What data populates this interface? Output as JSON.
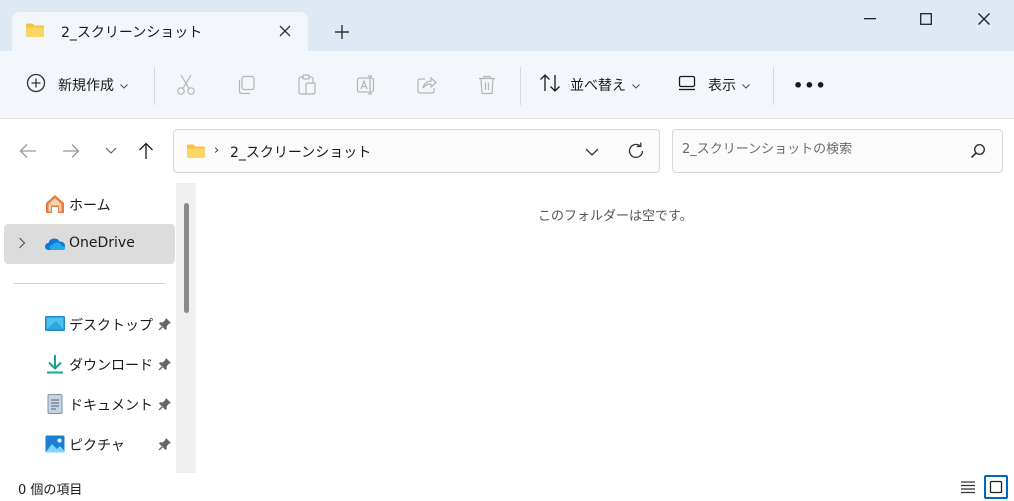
{
  "tab": {
    "title": "2_スクリーンショット",
    "icon": "folder-icon"
  },
  "window": {
    "controls": [
      "minimize",
      "maximize",
      "close"
    ]
  },
  "toolbar": {
    "new_label": "新規作成",
    "sort_label": "並べ替え",
    "view_label": "表示",
    "more_label": "•••",
    "disabled_actions": [
      "cut",
      "copy",
      "paste",
      "rename",
      "share",
      "delete"
    ]
  },
  "address": {
    "crumb": "2_スクリーンショット",
    "separator": "›"
  },
  "search": {
    "placeholder": "2_スクリーンショットの検索"
  },
  "sidebar": {
    "items": [
      {
        "label": "ホーム",
        "icon": "home-icon"
      },
      {
        "label": "OneDrive",
        "icon": "cloud-icon",
        "selected": true
      },
      {
        "label": "デスクトップ",
        "icon": "desktop-icon",
        "pinned": true
      },
      {
        "label": "ダウンロード",
        "icon": "download-icon",
        "pinned": true
      },
      {
        "label": "ドキュメント",
        "icon": "document-icon",
        "pinned": true
      },
      {
        "label": "ピクチャ",
        "icon": "pictures-icon",
        "pinned": true
      }
    ]
  },
  "content": {
    "empty_message": "このフォルダーは空です。"
  },
  "status": {
    "item_count": "0 個の項目"
  },
  "colors": {
    "accent": "#0067c0",
    "titlebar": "#dfe9f4",
    "toolbar": "#f3f6fa",
    "folder": "#f5c242",
    "onedrive": "#0f78d4"
  }
}
